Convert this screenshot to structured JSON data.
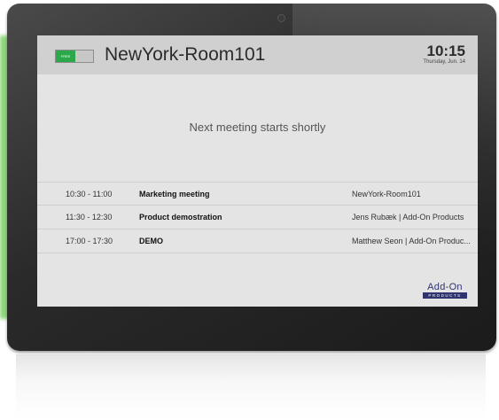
{
  "screen": {
    "status_label": "FREE",
    "room_name": "NewYork-Room101",
    "time": "10:15",
    "date": "Thursday, Jun. 14",
    "next_meeting_text": "Next meeting starts shortly",
    "meetings": [
      {
        "time": "10:30 - 11:00",
        "subject": "Marketing meeting",
        "organizer": "NewYork-Room101"
      },
      {
        "time": "11:30 - 12:30",
        "subject": "Product demostration",
        "organizer": "Jens Rubæk | Add-On Products"
      },
      {
        "time": "17:00 - 17:30",
        "subject": "DEMO",
        "organizer": "Matthew Seon | Add-On Produc..."
      }
    ],
    "logo": {
      "top": "Add-On",
      "bottom": "PRODUCTS"
    }
  },
  "colors": {
    "status_free": "#2aa84a",
    "header_bg": "#d0d0d0",
    "screen_bg": "#e4e4e4",
    "logo_brand": "#2f3470"
  }
}
